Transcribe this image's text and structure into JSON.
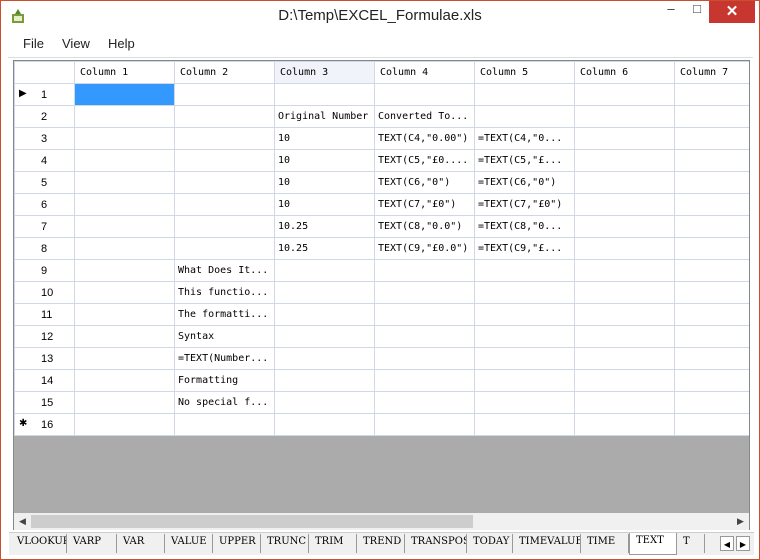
{
  "window": {
    "title": "D:\\Temp\\EXCEL_Formulae.xls",
    "minimize_glyph": "‒",
    "maximize_glyph": "□",
    "close_glyph": "✕"
  },
  "menu": [
    "File",
    "View",
    "Help"
  ],
  "columns": [
    "Column 1",
    "Column 2",
    "Column 3",
    "Column 4",
    "Column 5",
    "Column 6",
    "Column 7"
  ],
  "selected_column": 2,
  "selected_cell": {
    "row": 1,
    "col": 0
  },
  "rows": [
    {
      "num": "1",
      "symbol": "▶",
      "cells": [
        "",
        "",
        "",
        "",
        "",
        "",
        ""
      ]
    },
    {
      "num": "2",
      "symbol": "",
      "cells": [
        "",
        "",
        "Original Number",
        "Converted To...",
        "",
        "",
        ""
      ]
    },
    {
      "num": "3",
      "symbol": "",
      "cells": [
        "",
        "",
        "10",
        "TEXT(C4,\"0.00\")",
        "=TEXT(C4,\"0...",
        "",
        ""
      ]
    },
    {
      "num": "4",
      "symbol": "",
      "cells": [
        "",
        "",
        "10",
        "TEXT(C5,\"£0....",
        "=TEXT(C5,\"£...",
        "",
        ""
      ]
    },
    {
      "num": "5",
      "symbol": "",
      "cells": [
        "",
        "",
        "10",
        "TEXT(C6,\"0\")",
        "=TEXT(C6,\"0\")",
        "",
        ""
      ]
    },
    {
      "num": "6",
      "symbol": "",
      "cells": [
        "",
        "",
        "10",
        "TEXT(C7,\"£0\")",
        "=TEXT(C7,\"£0\")",
        "",
        ""
      ]
    },
    {
      "num": "7",
      "symbol": "",
      "cells": [
        "",
        "",
        "10.25",
        "TEXT(C8,\"0.0\")",
        "=TEXT(C8,\"0...",
        "",
        ""
      ]
    },
    {
      "num": "8",
      "symbol": "",
      "cells": [
        "",
        "",
        "10.25",
        "TEXT(C9,\"£0.0\")",
        "=TEXT(C9,\"£...",
        "",
        ""
      ]
    },
    {
      "num": "9",
      "symbol": "",
      "cells": [
        "",
        "What Does It...",
        "",
        "",
        "",
        "",
        ""
      ]
    },
    {
      "num": "10",
      "symbol": "",
      "cells": [
        "",
        "This functio...",
        "",
        "",
        "",
        "",
        ""
      ]
    },
    {
      "num": "11",
      "symbol": "",
      "cells": [
        "",
        "The formatti...",
        "",
        "",
        "",
        "",
        ""
      ]
    },
    {
      "num": "12",
      "symbol": "",
      "cells": [
        "",
        "Syntax",
        "",
        "",
        "",
        "",
        ""
      ]
    },
    {
      "num": "13",
      "symbol": "",
      "cells": [
        "",
        "=TEXT(Number...",
        "",
        "",
        "",
        "",
        ""
      ]
    },
    {
      "num": "14",
      "symbol": "",
      "cells": [
        "",
        "Formatting",
        "",
        "",
        "",
        "",
        ""
      ]
    },
    {
      "num": "15",
      "symbol": "",
      "cells": [
        "",
        "No special f...",
        "",
        "",
        "",
        "",
        ""
      ]
    },
    {
      "num": "16",
      "symbol": "✱",
      "cells": [
        "",
        "",
        "",
        "",
        "",
        "",
        ""
      ]
    }
  ],
  "scroll": {
    "left_glyph": "◀",
    "right_glyph": "▶"
  },
  "tabs": [
    "VLOOKUP",
    "VARP",
    "VAR",
    "VALUE",
    "UPPER",
    "TRUNC",
    "TRIM",
    "TREND",
    "TRANSPOSE",
    "TODAY",
    "TIMEVALUE",
    "TIME",
    "TEXT",
    "T"
  ],
  "active_tab": "TEXT",
  "tab_nav": {
    "prev_glyph": "◀",
    "next_glyph": "▶"
  }
}
